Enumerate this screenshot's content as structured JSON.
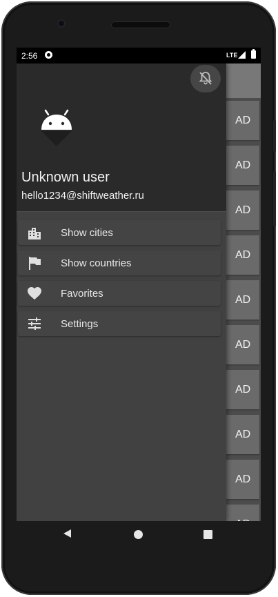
{
  "status_bar": {
    "time": "2:56",
    "network": "LTE",
    "notification_icon": "cast-app-icon",
    "signal_icon": "signal-icon",
    "battery_icon": "battery-icon"
  },
  "drawer": {
    "close_icon": "notifications-off-icon",
    "avatar_icon": "android-icon",
    "user_name": "Unknown user",
    "user_email": "hello1234@shiftweather.ru",
    "menu": [
      {
        "label": "Show cities",
        "icon": "city-icon"
      },
      {
        "label": "Show countries",
        "icon": "flag-icon"
      },
      {
        "label": "Favorites",
        "icon": "heart-icon"
      },
      {
        "label": "Settings",
        "icon": "sliders-icon"
      }
    ]
  },
  "content": {
    "ads": [
      "AD",
      "AD",
      "AD",
      "AD",
      "AD",
      "AD",
      "AD",
      "AD",
      "AD",
      "AD"
    ]
  },
  "nav_bar": {
    "back_icon": "back-triangle-icon",
    "home_icon": "home-circle-icon",
    "recents_icon": "recents-square-icon"
  },
  "colors": {
    "drawer_bg": "#414141",
    "drawer_header_bg": "#2a2a2a",
    "ad_item_bg": "#6a6a6a",
    "android_green_muted": "#ffffff"
  }
}
